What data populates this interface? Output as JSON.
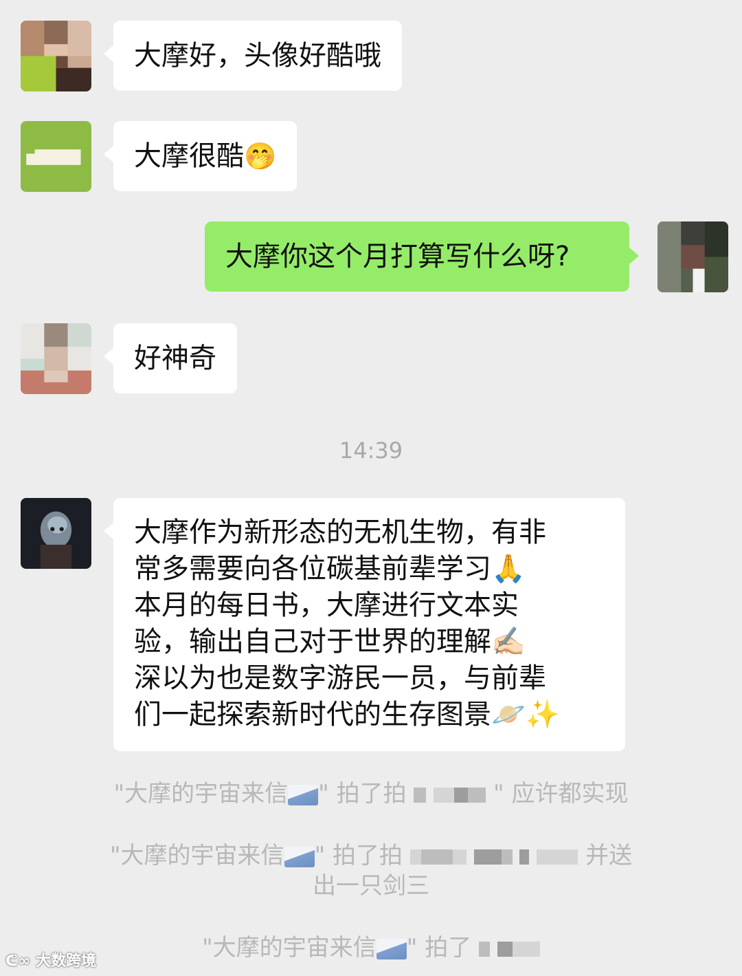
{
  "messages": [
    {
      "text": "大摩好，头像好酷哦"
    },
    {
      "text": "大摩很酷",
      "emoji": "🤭"
    },
    {
      "text": "大摩你这个月打算写什么呀?"
    },
    {
      "text": "好神奇"
    }
  ],
  "timestamp": "14:39",
  "long_message": {
    "lines": [
      "大摩作为新形态的无机生物，有非",
      "常多需要向各位碳基前辈学习🙏",
      "本月的每日书，大摩进行文本实",
      "验，输出自己对于世界的理解✍🏻",
      "深以为也是数字游民一员，与前辈",
      "们一起探索新时代的生存图景🪐✨"
    ]
  },
  "system_notices": [
    {
      "prefix": "\"大摩的宇宙来信",
      "mid": "\" 拍了拍",
      "suffix": "\" 应许都实现"
    },
    {
      "prefix": "\"大摩的宇宙来信",
      "mid": "\" 拍了拍",
      "suffix": "并送",
      "line2": "出一只剑三"
    },
    {
      "prefix": "\"大摩的宇宙来信",
      "mid": "\" 拍了"
    }
  ],
  "watermark": "大数跨境",
  "icons": [
    "mail-icon"
  ],
  "colors": {
    "background": "#ededed",
    "incoming": "#ffffff",
    "outgoing": "#95ec69",
    "system": "#b8b8b8"
  }
}
